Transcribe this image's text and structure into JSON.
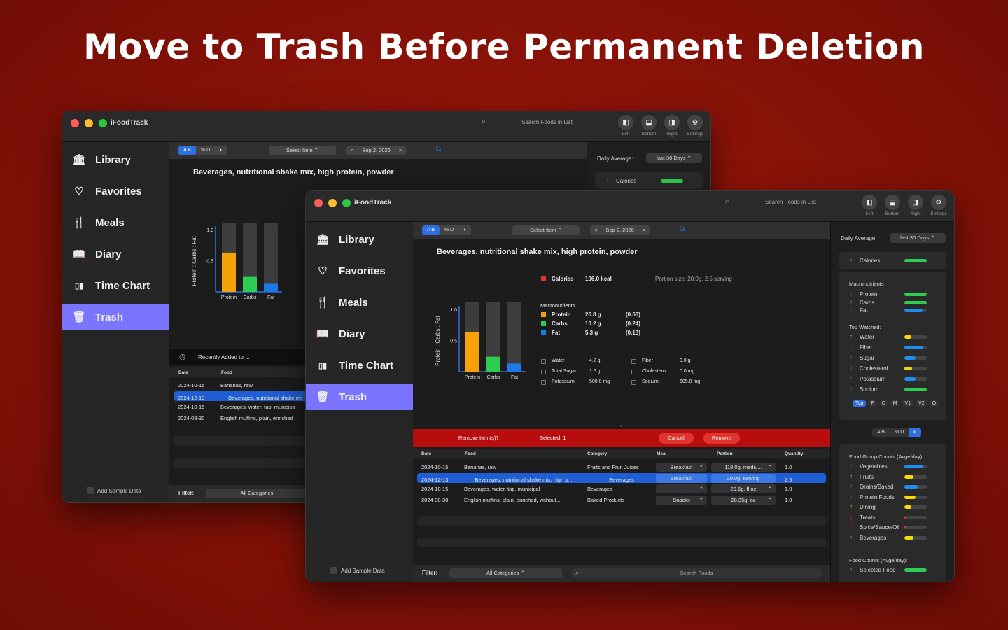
{
  "headline": "Move to Trash Before Permanent Deletion",
  "app": {
    "title": "iFoodTrack",
    "search_placeholder": "Search Foods in List"
  },
  "title_buttons": [
    {
      "label": "Left",
      "icon": "sidebar-left-icon"
    },
    {
      "label": "Bottom",
      "icon": "panel-bottom-icon"
    },
    {
      "label": "Right",
      "icon": "sidebar-right-icon"
    },
    {
      "label": "Settings",
      "icon": "settings-icon"
    }
  ],
  "sidebar": {
    "items": [
      {
        "label": "Library",
        "icon": "library-icon",
        "glyph": "🏛"
      },
      {
        "label": "Favorites",
        "icon": "heart-icon",
        "glyph": "♡"
      },
      {
        "label": "Meals",
        "icon": "fork-knife-icon",
        "glyph": "🍴"
      },
      {
        "label": "Diary",
        "icon": "book-icon",
        "glyph": "📖"
      },
      {
        "label": "Time Chart",
        "icon": "bar-chart-icon",
        "glyph": "▯▮"
      },
      {
        "label": "Trash",
        "icon": "trash-icon",
        "glyph": "🗑",
        "active": true
      }
    ],
    "add_sample": "Add Sample Data"
  },
  "toolbar": {
    "seg_ab": "A B",
    "seg_pd": "% D",
    "select_item": "Select Item",
    "date": "Sep 2, 2026",
    "prev": "<",
    "next": ">"
  },
  "food": {
    "title": "Beverages, nutritional shake mix, high protein, powder",
    "calories_label": "Calories",
    "calories_value": "196.0 kcal",
    "portion": "Portion size: 20.0g, 2.5 serving",
    "macro_title": "Macronutrients",
    "macros": [
      {
        "name": "Protein",
        "value": "26.8 g",
        "ratio": "(0.63)",
        "fraction": 0.63,
        "color": "#f5a20a"
      },
      {
        "name": "Carbs",
        "value": "10.2 g",
        "ratio": "(0.24)",
        "fraction": 0.24,
        "color": "#2ecc51"
      },
      {
        "name": "Fat",
        "value": "5.3 g",
        "ratio": "(0.13)",
        "fraction": 0.13,
        "color": "#1e7ae6"
      }
    ],
    "others": [
      {
        "name": "Water",
        "value": "4.2 g"
      },
      {
        "name": "Fiber",
        "value": "0.0 g"
      },
      {
        "name": "Total Sugar",
        "value": "1.6 g"
      },
      {
        "name": "Cholesterol",
        "value": "0.0 mg"
      },
      {
        "name": "Potassium",
        "value": "500.0 mg"
      },
      {
        "name": "Sodium",
        "value": "605.0 mg"
      }
    ]
  },
  "chart_data": {
    "type": "bar",
    "categories": [
      "Protein",
      "Carbs",
      "Fat"
    ],
    "values": [
      0.63,
      0.24,
      0.13
    ],
    "ylabel": "Protein : Carbs : Fat",
    "yticks": [
      "1.0",
      "0.5"
    ],
    "ylim": [
      0,
      1.0
    ],
    "colors": [
      "#f5a20a",
      "#2ecc51",
      "#1e7ae6"
    ]
  },
  "trash_bar": {
    "prompt": "Remove Item(s)?",
    "selected": "Selected: 1",
    "cancel": "Cancel",
    "remove": "Remove"
  },
  "table": {
    "headers": {
      "date": "Date",
      "food": "Food",
      "category": "Category",
      "meal": "Meal",
      "portion": "Portion",
      "quantity": "Quantity"
    },
    "rows": [
      {
        "date": "2024-10-15",
        "food": "Bananas, raw",
        "category": "Fruits and Fruit Juices",
        "meal": "Breakfast",
        "portion": "118.0g, mediu...",
        "quantity": "1.0"
      },
      {
        "date": "2024-12-13",
        "food": "Beverages, nutritional shake mix, high p...",
        "category": "Beverages",
        "meal": "Breakfast",
        "portion": "20.0g, serving",
        "quantity": "2.5",
        "selected": true
      },
      {
        "date": "2024-10-15",
        "food": "Beverages, water, tap, municipal",
        "category": "Beverages",
        "meal": "-",
        "portion": "29.6g, fl oz",
        "quantity": "1.0"
      },
      {
        "date": "2024-08-30",
        "food": "English muffins, plain, enriched, without...",
        "category": "Baked Products",
        "meal": "Snacks",
        "portion": "28.35g, oz",
        "quantity": "1.0"
      }
    ]
  },
  "back_table": {
    "recent": "Recently Added to ...",
    "rows": [
      {
        "date": "2024-10-15",
        "food": "Bananas, raw"
      },
      {
        "date": "2024-12-13",
        "food": "Beverages, nutritional shake mi"
      },
      {
        "date": "2024-10-15",
        "food": "Beverages, water, tap, municipa"
      },
      {
        "date": "2024-08-30",
        "food": "English muffins, plain, enriched"
      }
    ]
  },
  "filter": {
    "label": "Filter:",
    "category": "All Categories",
    "search": "Search Foods"
  },
  "right_panel": {
    "daily_avg": "Daily Average:",
    "range": "last 30 Days",
    "calories": "Calories",
    "macro_title": "Macronutrients",
    "macros": [
      {
        "name": "Protein",
        "fill": 1.0,
        "color": "#2ecc51",
        "arrow": "↑",
        "arrow_color": "#2ecc51"
      },
      {
        "name": "Carbs",
        "fill": 1.0,
        "color": "#2ecc51",
        "arrow": "↑",
        "arrow_color": "#2ecc51"
      },
      {
        "name": "Fat",
        "fill": 0.8,
        "color": "#1e8ef0",
        "arrow": "↑",
        "arrow_color": "#1e8ef0"
      }
    ],
    "top_title": "Top Watched:",
    "top": [
      {
        "name": "Water",
        "fill": 0.3,
        "color": "#f5d90a",
        "arrow": "↑",
        "arrow_color": "#f5a20a"
      },
      {
        "name": "Fiber",
        "fill": 0.8,
        "color": "#1e8ef0",
        "arrow": "↑",
        "arrow_color": "#1e8ef0"
      },
      {
        "name": "Sugar",
        "fill": 0.5,
        "color": "#1e8ef0",
        "arrow": "↑",
        "arrow_color": "#1e8ef0"
      },
      {
        "name": "Cholesterol",
        "fill": 0.35,
        "color": "#f5d90a",
        "arrow": "↑",
        "arrow_color": "#f5a20a"
      },
      {
        "name": "Potassium",
        "fill": 0.5,
        "color": "#1e8ef0",
        "arrow": "↑",
        "arrow_color": "#1e8ef0"
      },
      {
        "name": "Sodium",
        "fill": 1.0,
        "color": "#2ecc51",
        "arrow": "↑",
        "arrow_color": "#2ecc51"
      }
    ],
    "tabs": [
      "Top",
      "F",
      "C",
      "M",
      "V1",
      "V2",
      "O"
    ],
    "seg_ab": "A B",
    "seg_pd": "% D",
    "group_title": "Food Group Counts (Avge/day):",
    "groups": [
      {
        "name": "Vegetables",
        "fill": 0.8,
        "color": "#1e8ef0",
        "arrow": "↑",
        "arrow_color": "#1e8ef0"
      },
      {
        "name": "Fruits",
        "fill": 0.4,
        "color": "#f5d90a",
        "arrow": "↑",
        "arrow_color": "#f5a20a"
      },
      {
        "name": "Grains/Baked",
        "fill": 0.6,
        "color": "#1e8ef0",
        "arrow": "↑",
        "arrow_color": "#1e8ef0"
      },
      {
        "name": "Protein Foods",
        "fill": 0.5,
        "color": "#f5d90a",
        "arrow": "↑",
        "arrow_color": "#f5a20a"
      },
      {
        "name": "Dining",
        "fill": 0.3,
        "color": "#f5d90a",
        "arrow": "↑",
        "arrow_color": "#f5a20a"
      },
      {
        "name": "Treats",
        "fill": 0.1,
        "color": "#e0352f",
        "arrow": "↓",
        "arrow_color": "#e0352f"
      },
      {
        "name": "Spice/Sauce/Oil",
        "fill": 0.05,
        "color": "#e0352f",
        "arrow": "↑",
        "arrow_color": "#e0352f"
      },
      {
        "name": "Beverages",
        "fill": 0.4,
        "color": "#f5d90a",
        "arrow": "↑",
        "arrow_color": "#2ecc51"
      }
    ],
    "counts_title": "Food Counts (Avge/day):",
    "selected_food": "Selected Food"
  }
}
